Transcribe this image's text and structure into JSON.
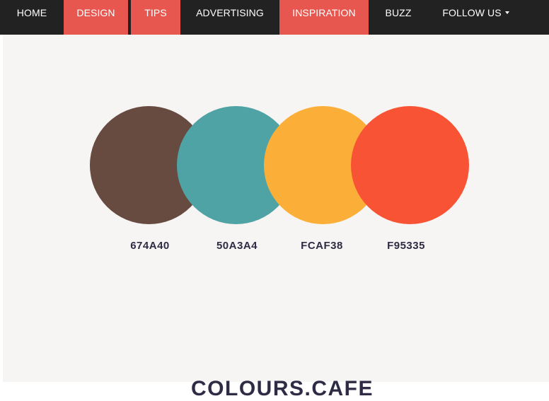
{
  "nav": {
    "items": [
      {
        "label": "HOME"
      },
      {
        "label": "DESIGN"
      },
      {
        "label": "TIPS"
      },
      {
        "label": "ADVERTISING"
      },
      {
        "label": "INSPIRATION"
      },
      {
        "label": "BUZZ"
      },
      {
        "label": "FOLLOW US"
      }
    ],
    "active_color": "#e8574f"
  },
  "palette": {
    "swatches": [
      {
        "hex": "674A40",
        "color": "#674A40"
      },
      {
        "hex": "50A3A4",
        "color": "#50A3A4"
      },
      {
        "hex": "FCAF38",
        "color": "#FCAF38"
      },
      {
        "hex": "F95335",
        "color": "#F95335"
      }
    ]
  },
  "footer": {
    "brand": "COLOURS.CAFE"
  }
}
